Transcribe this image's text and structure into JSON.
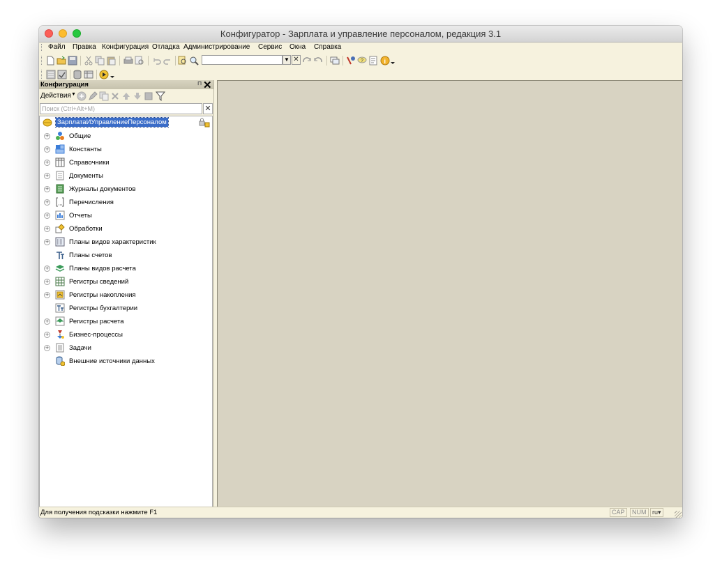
{
  "window": {
    "title": "Конфигуратор - Зарплата и управление персоналом, редакция 3.1"
  },
  "menu": [
    {
      "label": "Файл"
    },
    {
      "label": "Правка"
    },
    {
      "label": "Конфигурация"
    },
    {
      "label": "Отладка"
    },
    {
      "label": "Администрирование"
    },
    {
      "label": "Сервис"
    },
    {
      "label": "Окна"
    },
    {
      "label": "Справка"
    }
  ],
  "toolbar": {
    "search_value": "",
    "icons": [
      "new-document-icon",
      "open-folder-icon",
      "save-icon",
      "cut-icon",
      "copy-icon",
      "paste-icon",
      "print-icon",
      "print-preview-icon",
      "undo-icon",
      "redo-icon",
      "find-in-file-icon",
      "find-icon",
      "search-dropdown-icon",
      "clear-search-icon",
      "search-next-icon",
      "search-prev-icon",
      "windows-icon",
      "syntax-assistant-icon",
      "help-chat-icon",
      "help-book-icon",
      "info-icon"
    ]
  },
  "panel": {
    "title": "Конфигурация",
    "actions_label": "Действия",
    "search_placeholder": "Поиск (Ctrl+Alt+M)",
    "root_label": "ЗарплатаИУправлениеПерсоналом",
    "items": [
      {
        "label": "Общие",
        "icon": "common-icon",
        "expandable": true
      },
      {
        "label": "Константы",
        "icon": "constants-icon",
        "expandable": true
      },
      {
        "label": "Справочники",
        "icon": "catalogs-icon",
        "expandable": true
      },
      {
        "label": "Документы",
        "icon": "documents-icon",
        "expandable": true
      },
      {
        "label": "Журналы документов",
        "icon": "document-journals-icon",
        "expandable": true
      },
      {
        "label": "Перечисления",
        "icon": "enumerations-icon",
        "expandable": true
      },
      {
        "label": "Отчеты",
        "icon": "reports-icon",
        "expandable": true
      },
      {
        "label": "Обработки",
        "icon": "data-processors-icon",
        "expandable": true
      },
      {
        "label": "Планы видов характеристик",
        "icon": "chart-of-characteristic-types-icon",
        "expandable": true
      },
      {
        "label": "Планы счетов",
        "icon": "chart-of-accounts-icon",
        "expandable": false
      },
      {
        "label": "Планы видов расчета",
        "icon": "chart-of-calculation-types-icon",
        "expandable": true
      },
      {
        "label": "Регистры сведений",
        "icon": "information-registers-icon",
        "expandable": true
      },
      {
        "label": "Регистры накопления",
        "icon": "accumulation-registers-icon",
        "expandable": true
      },
      {
        "label": "Регистры бухгалтерии",
        "icon": "accounting-registers-icon",
        "expandable": false
      },
      {
        "label": "Регистры расчета",
        "icon": "calculation-registers-icon",
        "expandable": true
      },
      {
        "label": "Бизнес-процессы",
        "icon": "business-processes-icon",
        "expandable": true
      },
      {
        "label": "Задачи",
        "icon": "tasks-icon",
        "expandable": true
      },
      {
        "label": "Внешние источники данных",
        "icon": "external-data-sources-icon",
        "expandable": false
      }
    ]
  },
  "status": {
    "message": "Для получения подсказки нажмите F1",
    "cap": "CAP",
    "num": "NUM",
    "lang": "ru"
  }
}
